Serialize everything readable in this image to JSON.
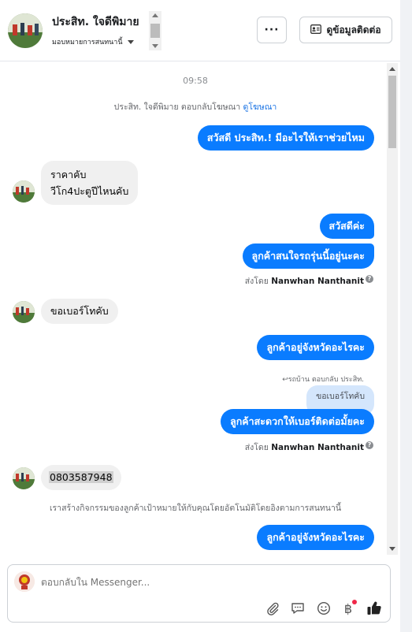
{
  "header": {
    "contact_name": "ประสิท. ใจดีพิมาย",
    "assign_label": "มอบหมายการสนทนานี้",
    "more_label": "···",
    "contact_info_label": "ดูข้อมูลติดต่อ"
  },
  "conversation": {
    "timestamp": "09:58",
    "ad_reply_text": "ประสิท. ใจดีพิมาย ตอบกลับโฆษณา",
    "ad_link": "ดูโฆษณา",
    "messages": [
      {
        "text": "สวัสดี ประสิท.! มีอะไรให้เราช่วยไหม"
      },
      {
        "line1": "ราคาคับ",
        "line2": "วีโก4ปะตูปีไหนคับ"
      },
      {
        "text": "สวัสดีค่ะ"
      },
      {
        "text": "ลูกค้าสนใจรถรุ่นนี้อยู่นะคะ"
      },
      {
        "text": "ขอเบอร์โทคับ"
      },
      {
        "text": "ลูกค้าอยู่จังหวัดอะไรคะ"
      },
      {
        "text": "ลูกค้าสะดวกให้เบอร์ติดต่อมั้ยคะ"
      },
      {
        "text": "0803587948"
      },
      {
        "text": "ลูกค้าอยู่จังหวัดอะไรคะ"
      }
    ],
    "sent_by_label": "ส่งโดย",
    "sender_name": "Nanwhan Nanthanit",
    "reply_meta": "รถบ้าน ตอบกลับ ประสิท.",
    "quoted_text": "ขอเบอร์โทคับ",
    "system_notice": "เราสร้างกิจกรรมของลูกค้าเป้าหมายให้กับคุณโดยอัตโนมัติโดยอิงตามการสนทนานี้"
  },
  "composer": {
    "placeholder": "ตอบกลับใน Messenger..."
  },
  "colors": {
    "outgoing_bubble": "#0a7cff",
    "incoming_bubble": "#f0f0f0",
    "link": "#1b74e4",
    "notification_dot": "#f02849"
  },
  "icons": [
    "chevron-down-icon",
    "contact-card-icon",
    "help-icon",
    "reply-arrow-icon",
    "attachment-icon",
    "chat-bubble-icon",
    "emoji-icon",
    "baht-icon",
    "thumbs-up-icon"
  ]
}
